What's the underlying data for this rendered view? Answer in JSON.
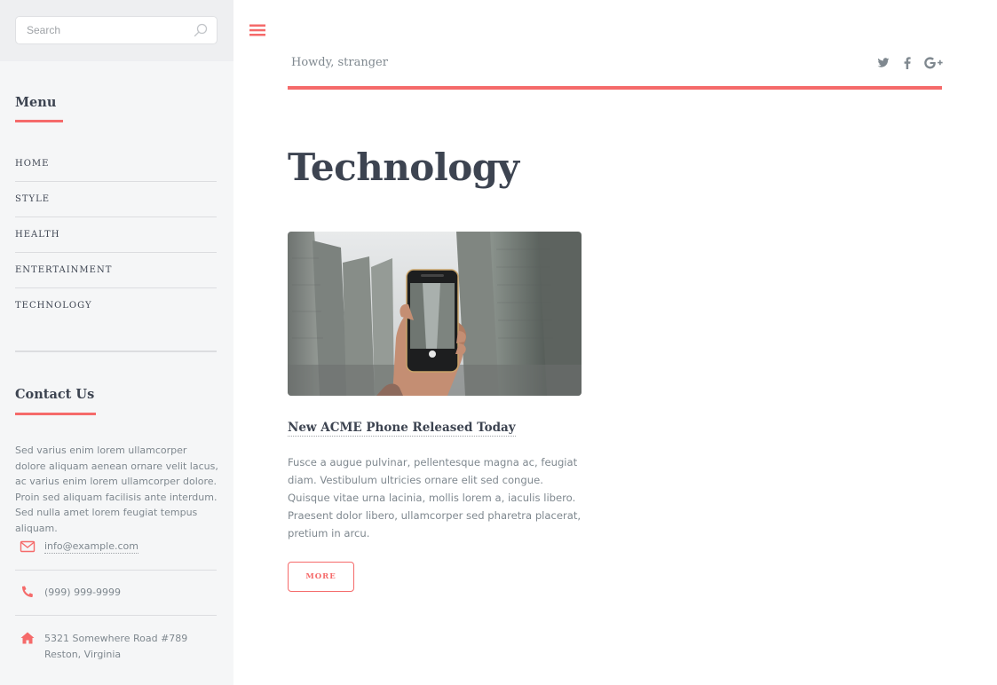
{
  "search": {
    "placeholder": "Search"
  },
  "sidebar": {
    "menu_heading": "Menu",
    "menu_items": [
      {
        "label": "HOME"
      },
      {
        "label": "STYLE"
      },
      {
        "label": "HEALTH"
      },
      {
        "label": "ENTERTAINMENT"
      },
      {
        "label": "TECHNOLOGY"
      }
    ],
    "contact_heading": "Contact Us",
    "contact_description": "Sed varius enim lorem ullamcorper dolore aliquam aenean ornare velit lacus, ac varius enim lorem ullamcorper dolore. Proin sed aliquam facilisis ante interdum. Sed nulla amet lorem feugiat tempus aliquam.",
    "contact_email": "info@example.com",
    "contact_phone": "(999) 999-9999",
    "contact_address_line1": "5321 Somewhere Road #789",
    "contact_address_line2": "Reston, Virginia"
  },
  "header": {
    "greeting": "Howdy, stranger",
    "social_icons": [
      "twitter-icon",
      "facebook-icon",
      "google-plus-icon"
    ],
    "menu_icon": "hamburger-icon"
  },
  "main": {
    "page_title": "Technology",
    "article": {
      "title": "New ACME Phone Released Today",
      "body": "Fusce a augue pulvinar, pellentesque magna ac, feugiat diam. Vestibulum ultricies ornare elit sed congue. Quisque vitae urna lacinia, mollis lorem a, iaculis libero. Praesent dolor libero, ullamcorper sed pharetra placerat, pretium in arcu.",
      "button_label": "MORE",
      "image": "phone-photo-image"
    }
  },
  "colors": {
    "accent": "#f56a6a",
    "heading": "#3d4451",
    "body_text": "#7f888f",
    "sidebar_bg": "#f5f6f7"
  }
}
